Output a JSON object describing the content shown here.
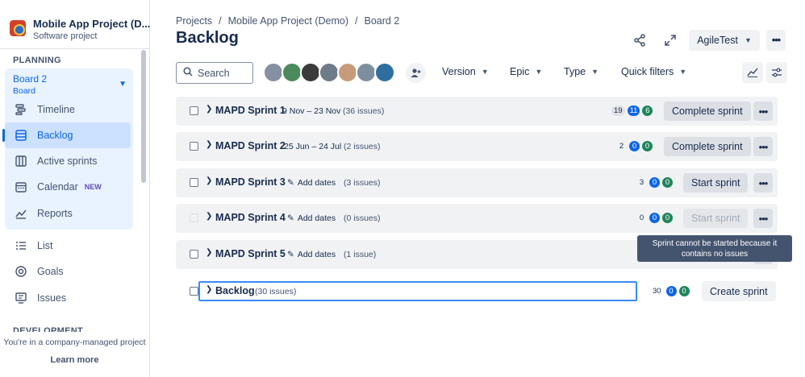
{
  "project": {
    "name": "Mobile App Project (D...",
    "type": "Software project"
  },
  "sidebar": {
    "planning_heading": "PLANNING",
    "board": {
      "name": "Board 2",
      "sub": "Board"
    },
    "items": [
      {
        "label": "Timeline",
        "icon": "timeline-icon"
      },
      {
        "label": "Backlog",
        "icon": "backlog-icon",
        "active": true
      },
      {
        "label": "Active sprints",
        "icon": "board-icon"
      },
      {
        "label": "Calendar",
        "icon": "calendar-icon",
        "badge": "NEW"
      },
      {
        "label": "Reports",
        "icon": "reports-icon"
      },
      {
        "label": "List",
        "icon": "list-icon"
      },
      {
        "label": "Goals",
        "icon": "goals-icon"
      },
      {
        "label": "Issues",
        "icon": "issues-icon"
      }
    ],
    "development_heading": "DEVELOPMENT",
    "footer_text": "You're in a company-managed project",
    "footer_link": "Learn more"
  },
  "breadcrumbs": [
    "Projects",
    "Mobile App Project (Demo)",
    "Board 2"
  ],
  "title": "Backlog",
  "header_actions": {
    "app_button": "AgileTest"
  },
  "filters": {
    "search_placeholder": "Search",
    "dropdowns": [
      "Version",
      "Epic",
      "Type",
      "Quick filters"
    ]
  },
  "sprints": [
    {
      "name": "MAPD Sprint 1",
      "dates": "9 Nov – 23 Nov",
      "count": "(36 issues)",
      "todo": "19",
      "in_progress": "11",
      "done": "6",
      "action": "Complete sprint"
    },
    {
      "name": "MAPD Sprint 2",
      "dates": "25 Jun – 24 Jul",
      "count": "(2 issues)",
      "todo": "2",
      "in_progress": "0",
      "done": "0",
      "action": "Complete sprint"
    },
    {
      "name": "MAPD Sprint 3",
      "add_dates": "Add dates",
      "count": "(3 issues)",
      "todo": "3",
      "in_progress": "0",
      "done": "0",
      "action": "Start sprint"
    },
    {
      "name": "MAPD Sprint 4",
      "add_dates": "Add dates",
      "count": "(0 issues)",
      "todo": "0",
      "in_progress": "0",
      "done": "0",
      "action": "Start sprint"
    },
    {
      "name": "MAPD Sprint 5",
      "add_dates": "Add dates",
      "count": "(1 issue)"
    }
  ],
  "backlog": {
    "name": "Backlog",
    "count": "(30 issues)",
    "todo": "30",
    "in_progress": "0",
    "done": "0",
    "action": "Create sprint"
  },
  "tooltip": "Sprint cannot be started because it contains no issues",
  "colors": {
    "accent": "#0c66e4",
    "done": "#1f845a",
    "tooltip_bg": "#44546f"
  }
}
